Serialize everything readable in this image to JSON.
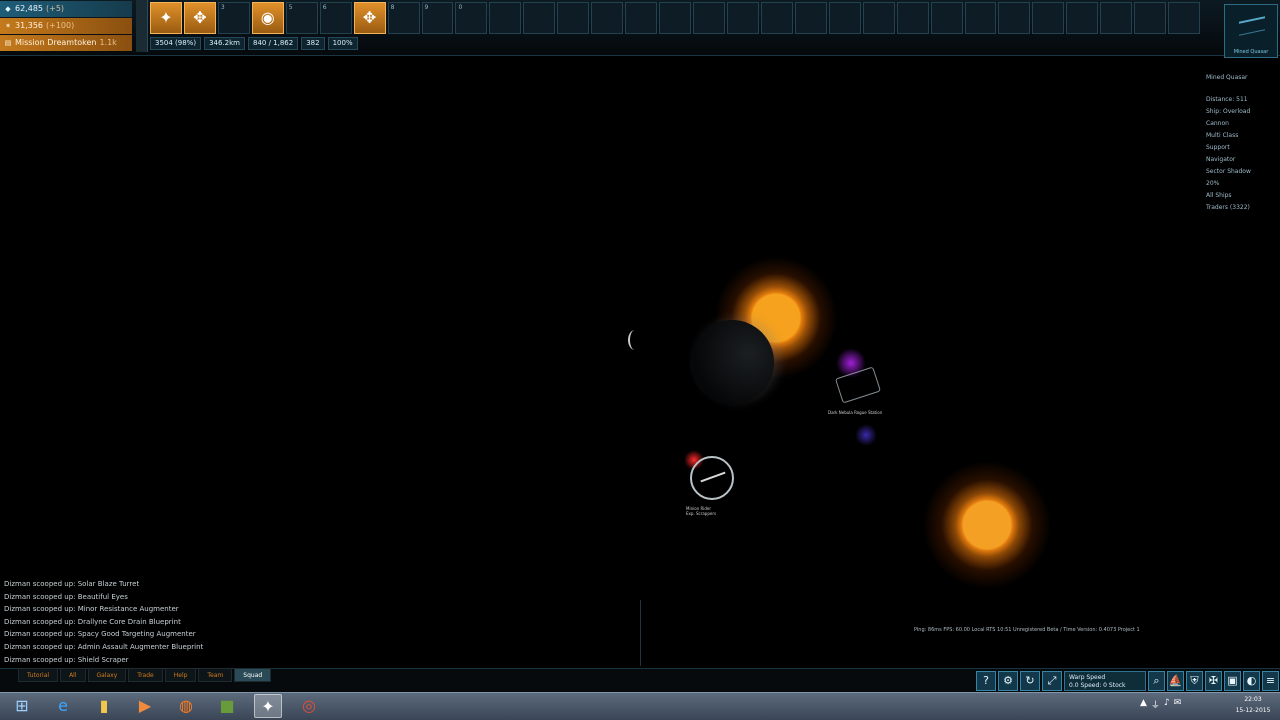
{
  "stats": {
    "credits": {
      "value": "62,485",
      "sub": "(+5)"
    },
    "scrap": {
      "value": "31,356",
      "sub": "(+100)"
    },
    "blueprints": {
      "value": "Mission Dreamtoken",
      "sub": "1.1k"
    }
  },
  "hotbar": {
    "slots": [
      {
        "num": "",
        "icon": "ability-icon",
        "glyph": "✦",
        "active": true
      },
      {
        "num": "",
        "icon": "target-icon",
        "glyph": "✥",
        "active": true
      },
      {
        "num": "3",
        "icon": "",
        "glyph": "",
        "active": false
      },
      {
        "num": "",
        "icon": "shield-icon",
        "glyph": "◉",
        "active": true
      },
      {
        "num": "5",
        "icon": "",
        "glyph": "",
        "active": false
      },
      {
        "num": "6",
        "icon": "",
        "glyph": "",
        "active": false
      },
      {
        "num": "",
        "icon": "target-icon",
        "glyph": "✥",
        "active": true
      },
      {
        "num": "8",
        "icon": "",
        "glyph": "",
        "active": false
      },
      {
        "num": "9",
        "icon": "",
        "glyph": "",
        "active": false
      },
      {
        "num": "0",
        "icon": "",
        "glyph": "",
        "active": false
      }
    ],
    "empty_count": 21
  },
  "resources": [
    "3504 (98%)",
    "346.2km",
    "840 / 1,862",
    "382",
    "100%"
  ],
  "minimap": {
    "label": "Mined Quasar"
  },
  "info_panel": {
    "header": "Mined Quasar",
    "lines": [
      "Distance: 511",
      "Ship: Overload",
      "Cannon",
      "Multi Class",
      "Support",
      "Navigator",
      "Sector Shadow",
      "20%",
      "All Ships",
      "Traders (3322)"
    ]
  },
  "labels": {
    "station": "Dark Nebula Rogue Station",
    "player": "Minion Rider\nExp. Scrappers"
  },
  "overlay_status": "Ping: 86ms    FPS: 60.00    Local RTS 10:51        Unregistered Beta / Time        Version: 0.4073 Project 1",
  "chat": {
    "lines": [
      "Dizman scooped up: Solar Blaze Turret",
      "Dizman scooped up: Beautiful Eyes",
      "Dizman scooped up: Minor Resistance Augmenter",
      "Dizman scooped up: Drallyne Core Drain Blueprint",
      "Dizman scooped up: Spacy Good Targeting Augmenter",
      "Dizman scooped up: Admin Assault Augmenter Blueprint",
      "Dizman scooped up: Shield Scraper"
    ],
    "tabs": [
      "Tutorial",
      "All",
      "Galaxy",
      "Trade",
      "Help",
      "Team",
      "Squad"
    ],
    "active_tab": "Squad"
  },
  "action_bar": {
    "buttons_left": [
      {
        "name": "help-icon",
        "glyph": "?"
      },
      {
        "name": "gear-icon",
        "glyph": "⚙"
      },
      {
        "name": "refresh-icon",
        "glyph": "↻"
      },
      {
        "name": "expand-icon",
        "glyph": "⤢"
      }
    ],
    "speed": {
      "title": "Warp Speed",
      "value": "0.0 Speed: 0 Stock"
    },
    "buttons_right": [
      {
        "name": "zoom-icon",
        "glyph": "⌕"
      },
      {
        "name": "ship-icon",
        "glyph": "⛵"
      },
      {
        "name": "shield-icon",
        "glyph": "⛨"
      },
      {
        "name": "wrench-icon",
        "glyph": "✠"
      },
      {
        "name": "cargo-icon",
        "glyph": "▣"
      },
      {
        "name": "globe-icon",
        "glyph": "◐"
      },
      {
        "name": "menu-icon",
        "glyph": "≡"
      }
    ]
  },
  "taskbar": {
    "buttons": [
      {
        "name": "start-icon",
        "glyph": "⊞",
        "color": "#9fd0ff",
        "active": false
      },
      {
        "name": "ie-icon",
        "glyph": "e",
        "color": "#3fa6ff",
        "active": false
      },
      {
        "name": "folder-icon",
        "glyph": "▮",
        "color": "#f2c84b",
        "active": false
      },
      {
        "name": "media-icon",
        "glyph": "▶",
        "color": "#f08a3c",
        "active": false
      },
      {
        "name": "firefox-icon",
        "glyph": "◍",
        "color": "#ff7a1a",
        "active": false
      },
      {
        "name": "minecraft-icon",
        "glyph": "■",
        "color": "#6a9b3a",
        "active": false
      },
      {
        "name": "game-icon",
        "glyph": "✦",
        "color": "#ffffff",
        "active": true
      },
      {
        "name": "chrome-icon",
        "glyph": "◎",
        "color": "#e84b3a",
        "active": false
      }
    ],
    "tray": [
      "▲",
      "⏚",
      "♪",
      "✉"
    ],
    "clock": {
      "time": "22:03",
      "date": "15-12-2015"
    }
  }
}
